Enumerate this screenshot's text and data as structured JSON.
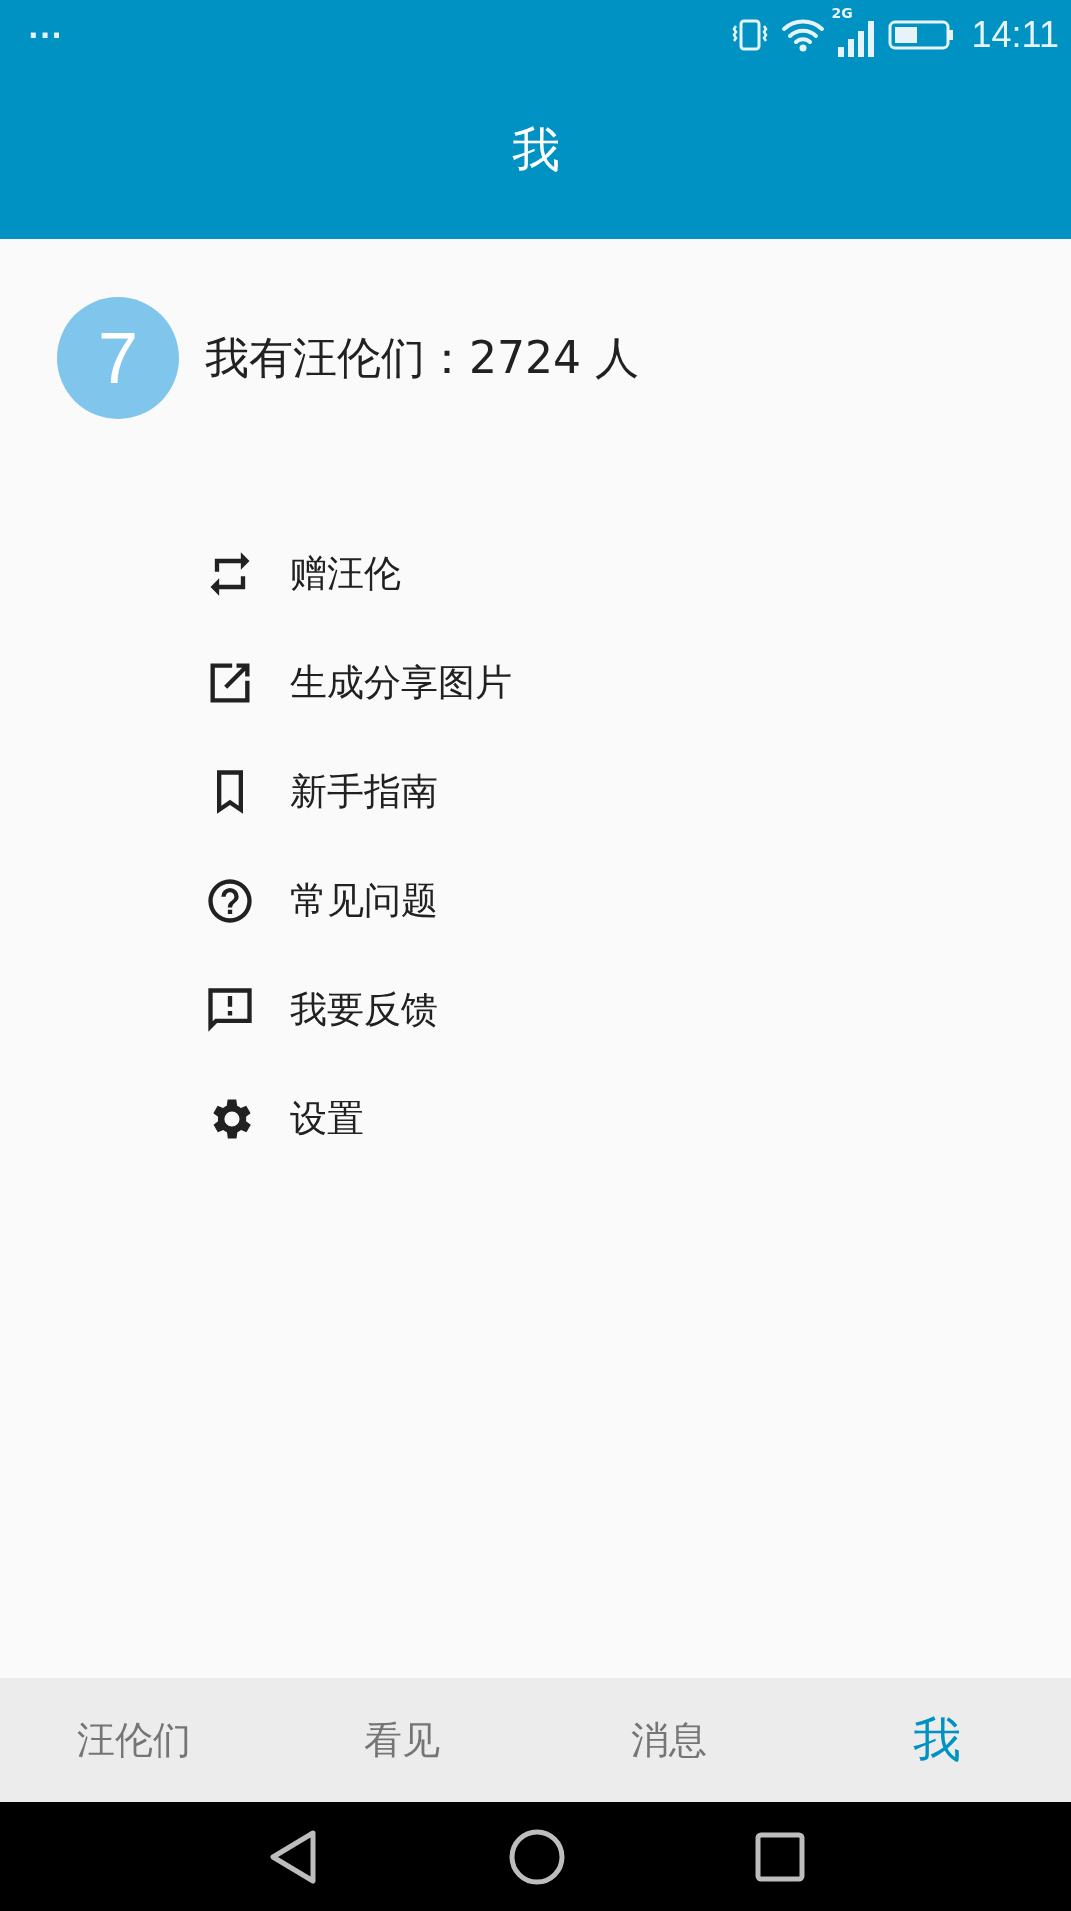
{
  "status_bar": {
    "dots": "···",
    "network": "2G",
    "time": "14:11"
  },
  "header": {
    "title": "我"
  },
  "profile": {
    "avatar": "7",
    "summary": "我有汪伦们：2724 人"
  },
  "menu": [
    {
      "kind": "swap",
      "label": "赠汪伦"
    },
    {
      "kind": "share",
      "label": "生成分享图片"
    },
    {
      "kind": "bookmark",
      "label": "新手指南"
    },
    {
      "kind": "help",
      "label": "常见问题"
    },
    {
      "kind": "feedback",
      "label": "我要反馈"
    },
    {
      "kind": "settings",
      "label": "设置"
    }
  ],
  "tabs": [
    {
      "label": "汪伦们",
      "selected": false
    },
    {
      "label": "看见",
      "selected": false
    },
    {
      "label": "消息",
      "selected": false
    },
    {
      "label": "我",
      "selected": true
    }
  ]
}
